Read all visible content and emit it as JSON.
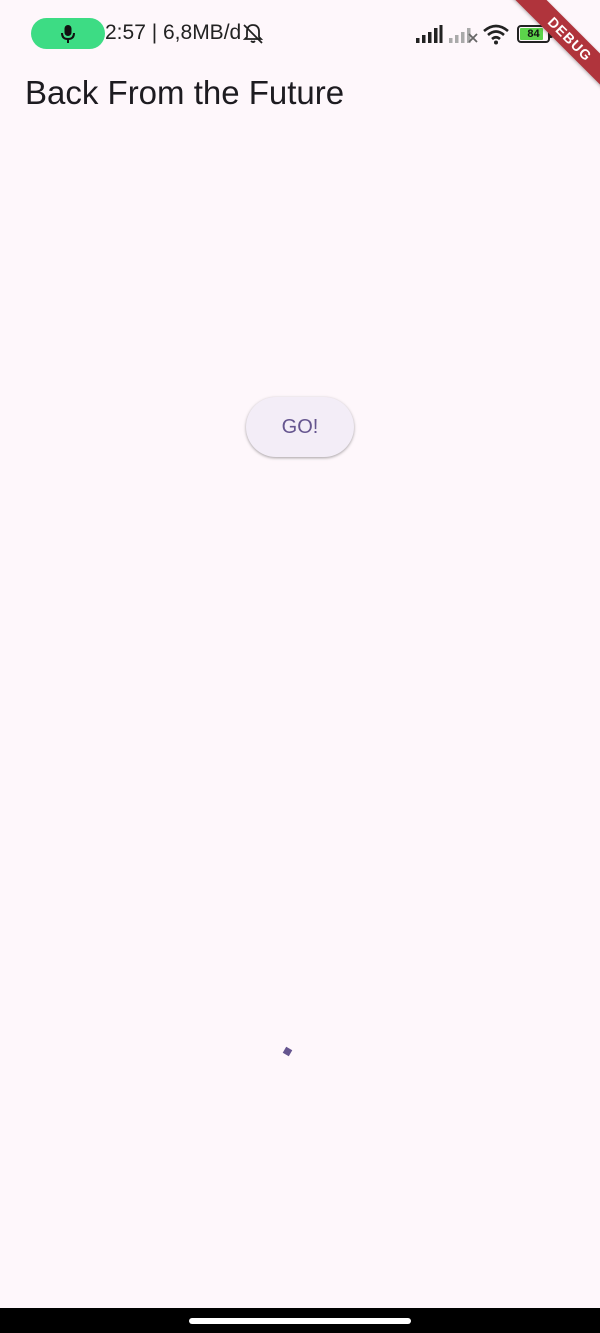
{
  "status_bar": {
    "time_and_data": "2:57 | 6,8MB/d",
    "battery_level": "84",
    "battery_fraction": 0.84,
    "icons": [
      "mic-icon",
      "bell-off-icon",
      "signal-icon",
      "signal-no-service-icon",
      "wifi-icon",
      "battery-icon"
    ]
  },
  "debug_banner": {
    "label": "DEBUG"
  },
  "app_bar": {
    "title": "Back From the Future"
  },
  "main": {
    "button_label": "GO!"
  },
  "colors": {
    "background": "#FEF7FB",
    "accent": "#65558F",
    "button_surface": "#F3EDF7",
    "mic_pill": "#3DDC84",
    "debug_banner": "#B0343C",
    "battery_fill": "#5CD34B"
  }
}
